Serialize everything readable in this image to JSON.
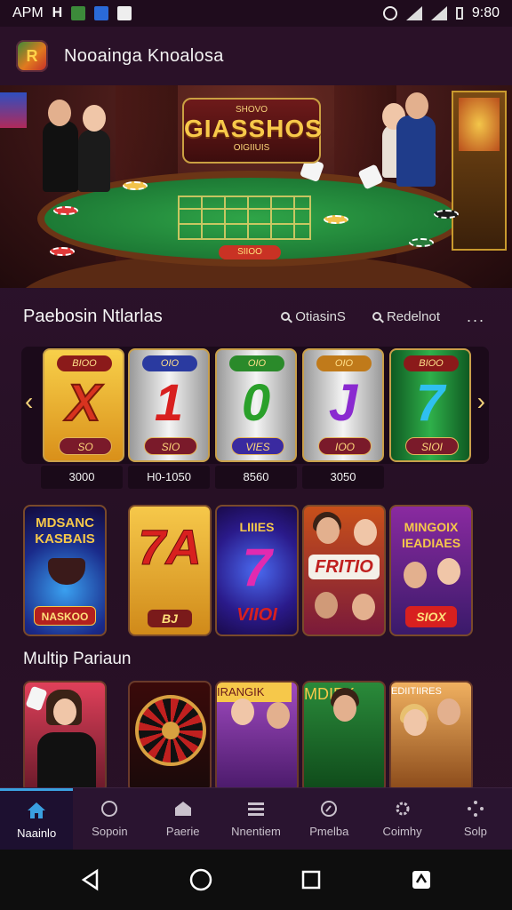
{
  "status_bar": {
    "carrier": "APM",
    "carrier_suffix": "H",
    "time": "9:80"
  },
  "app_bar": {
    "logo_letter": "R",
    "title": "Nooainga Knoalosa"
  },
  "hero": {
    "logo_top": "SHOVO",
    "logo_main": "GIASSHOS",
    "logo_sub": "OIGIIUIS",
    "table_label": "SIIOO"
  },
  "section1": {
    "title": "Paebosin Ntlarlas",
    "link1": "OtiasinS",
    "link2": "Redelnot",
    "more": "..."
  },
  "reels": [
    {
      "top": "BIOO",
      "symbol": "X",
      "bottom": "SO",
      "value": "3000",
      "theme": "gold"
    },
    {
      "top": "OIO",
      "symbol": "1",
      "bottom": "SIO",
      "value": "H0-1050",
      "theme": "silver"
    },
    {
      "top": "OIO",
      "symbol": "0",
      "bottom": "VIES",
      "value": "8560",
      "theme": "silver"
    },
    {
      "top": "OIO",
      "symbol": "J",
      "bottom": "IOO",
      "value": "3050",
      "theme": "silver"
    },
    {
      "top": "BIOO",
      "symbol": "7",
      "bottom": "SIOI",
      "value": "",
      "theme": "green"
    }
  ],
  "tiles_row1": [
    {
      "title": "MDSANC KASBAIS",
      "badge": "NASKOO"
    },
    {
      "big": "7A",
      "badge": "BJ"
    },
    {
      "title": "LIIIES",
      "big": "7",
      "badge": "VIIOI"
    },
    {
      "badge": "FRITIO"
    },
    {
      "title": "MINGOIX IEADIAES",
      "badge": "SIOX"
    }
  ],
  "section2": {
    "title": "Multip Pariaun"
  },
  "tiles_row2": [
    {
      "label": ""
    },
    {
      "label": ""
    },
    {
      "label": "IRANGIK"
    },
    {
      "label": "MDIEK"
    },
    {
      "label": "EDIITIIRES"
    }
  ],
  "bottom_nav": [
    {
      "label": "Naainlo",
      "icon": "home-icon",
      "active": true
    },
    {
      "label": "Sopoin",
      "icon": "shield-icon",
      "active": false
    },
    {
      "label": "Paerie",
      "icon": "house-icon",
      "active": false
    },
    {
      "label": "Nnentiem",
      "icon": "list-icon",
      "active": false
    },
    {
      "label": "Pmelba",
      "icon": "compass-icon",
      "active": false
    },
    {
      "label": "Coimhy",
      "icon": "gear-icon",
      "active": false
    },
    {
      "label": "Solp",
      "icon": "dots-icon",
      "active": false
    }
  ],
  "colors": {
    "accent": "#3aa0e0",
    "background": "#2a1027",
    "gold": "#f2c24a"
  }
}
